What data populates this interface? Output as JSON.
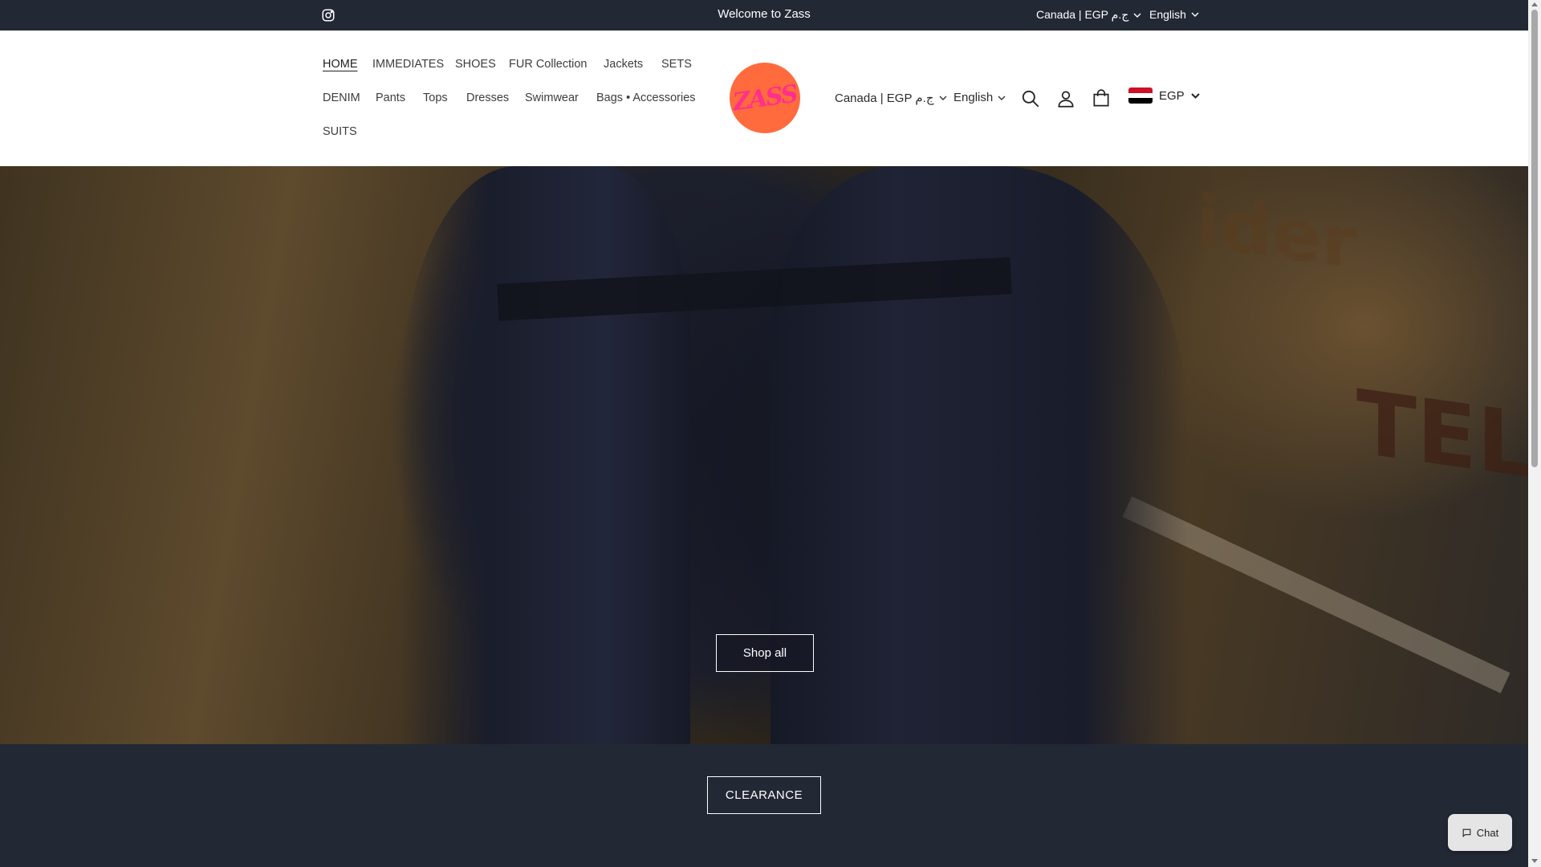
{
  "announcement": {
    "welcome": "Welcome to Zass",
    "country": "Canada | EGP ج.م",
    "language": "English",
    "social_icon": "instagram-icon"
  },
  "header": {
    "nav": [
      {
        "label": "HOME",
        "active": true
      },
      {
        "label": "IMMEDIATES"
      },
      {
        "label": "SHOES"
      },
      {
        "label": "FUR Collection"
      },
      {
        "label": "Jackets"
      },
      {
        "label": "SETS"
      },
      {
        "label": "DENIM"
      },
      {
        "label": "Pants"
      },
      {
        "label": "Tops"
      },
      {
        "label": "Dresses"
      },
      {
        "label": "Swimwear"
      },
      {
        "label": "Bags • Accessories"
      },
      {
        "label": "SUITS"
      }
    ],
    "logo_text": "ZASS",
    "country": "Canada | EGP ج.م",
    "language": "English",
    "currency": "EGP",
    "icons": [
      "search-icon",
      "account-icon",
      "cart-icon"
    ]
  },
  "hero": {
    "button": "Shop all"
  },
  "band": {
    "button": "CLEARANCE"
  },
  "chat": {
    "label": "Chat"
  },
  "colors": {
    "dark_bg": "#232835",
    "logo_bg": "#ff6b3d",
    "logo_text": "#ff2f8e"
  }
}
